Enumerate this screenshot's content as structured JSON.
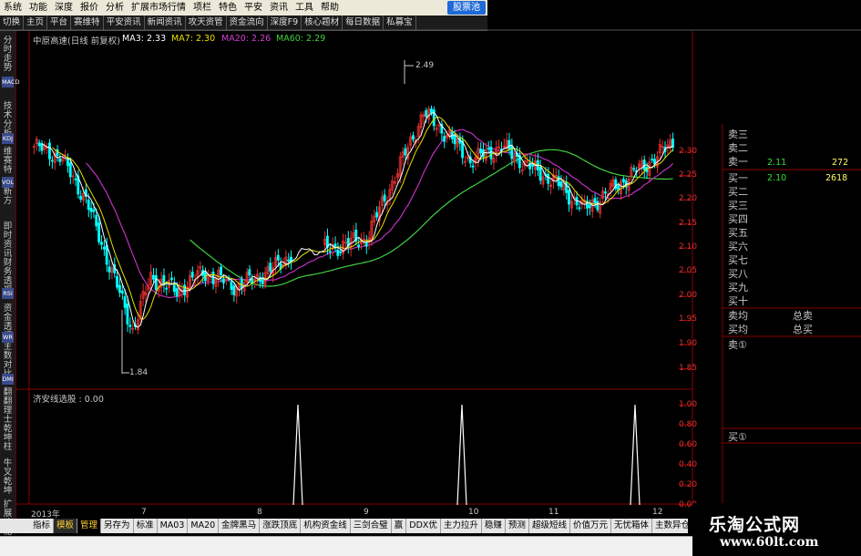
{
  "menubar": {
    "items": [
      "系统",
      "功能",
      "深度",
      "报价",
      "分析",
      "扩展市场行情",
      "项栏",
      "特色",
      "平安",
      "资讯",
      "工具",
      "帮助"
    ],
    "logo": "股票池"
  },
  "tabbar": {
    "items": [
      "切换",
      "主页",
      "平台",
      "赛维特",
      "平安资讯",
      "新闻资讯",
      "攻天资管",
      "资金流向",
      "深度F9",
      "核心题材",
      "每日数据",
      "私募宝"
    ]
  },
  "left_tabs": {
    "t1": "分时走势",
    "t2": "技术分析",
    "t3": "维赛特",
    "t4": "新方",
    "t5": "即时资讯",
    "t6": "财务透视",
    "t7": "资金透视",
    "t8": "主数对比",
    "t9": "翻翻理士",
    "t10": "乾坤柱",
    "t11": "牛叉乾坤",
    "t12": "扩展功能",
    "icons": [
      "MACD",
      "KDJ",
      "VOL",
      "RSI",
      "WR",
      "DMI"
    ]
  },
  "chart_header": {
    "stock": "中原高速(日线 前复权)",
    "ma3": "MA3: 2.33",
    "ma7": "MA7: 2.30",
    "ma20": "MA20: 2.26",
    "ma60": "MA60: 2.29"
  },
  "price_axis": [
    "2.30",
    "2.25",
    "2.20",
    "2.15",
    "2.10",
    "2.05",
    "2.00",
    "1.95",
    "1.90",
    "1.85"
  ],
  "high_label": "2.49",
  "low_label": "1.84",
  "sub_header": "济安线选股 : 0.00",
  "sub_axis": [
    "1.00",
    "0.80",
    "0.60",
    "0.40",
    "0.20",
    "0.00"
  ],
  "date_axis": {
    "year": "2013年",
    "months": [
      "7",
      "8",
      "9",
      "10",
      "11",
      "12"
    ]
  },
  "order_book": {
    "sell_labels": [
      "卖三",
      "卖二",
      "卖一"
    ],
    "buy_labels": [
      "买一",
      "买二",
      "买三",
      "买四",
      "买五",
      "买六",
      "买七",
      "买八",
      "买九",
      "买十"
    ],
    "sell1_price": "2.11",
    "sell1_qty": "272",
    "buy1_price": "2.10",
    "buy1_qty": "2618",
    "sell_avg": "卖均",
    "buy_avg": "买均",
    "total_sell": "总卖",
    "total_buy": "总买",
    "sell_circle": "卖①",
    "buy_circle": "买①"
  },
  "bottom_tabs": [
    "指标",
    "模板",
    "管理",
    "另存为",
    "标准",
    "MA03",
    "MA20",
    "金牌黑马",
    "涨跌顶底",
    "机构资金线",
    "三剑合璧",
    "赢",
    "DDX优",
    "主力拉升",
    "稳赚",
    "预测",
    "超级短线",
    "价值万元",
    "无忧箱体",
    "主数异仓",
    "≫"
  ],
  "watermark": {
    "line1": "乐淘公式网",
    "line2": "www.60lt.com"
  },
  "colors": {
    "up": "#e03030",
    "down": "#00ffff",
    "ma3": "#ffffff",
    "ma7": "#e8e000",
    "ma20": "#c030c0",
    "ma60": "#40d040",
    "grid": "#8a0000"
  },
  "chart_data": {
    "type": "candlestick",
    "series": [
      {
        "name": "MA3",
        "value": 2.33
      },
      {
        "name": "MA7",
        "value": 2.3
      },
      {
        "name": "MA20",
        "value": 2.26
      },
      {
        "name": "MA60",
        "value": 2.29
      }
    ],
    "ylim": [
      1.82,
      2.36
    ],
    "high": 2.49,
    "low": 1.84,
    "indicator": {
      "name": "济安线选股",
      "value": 0.0,
      "ylim": [
        0,
        1.0
      ],
      "spikes": 3
    }
  }
}
